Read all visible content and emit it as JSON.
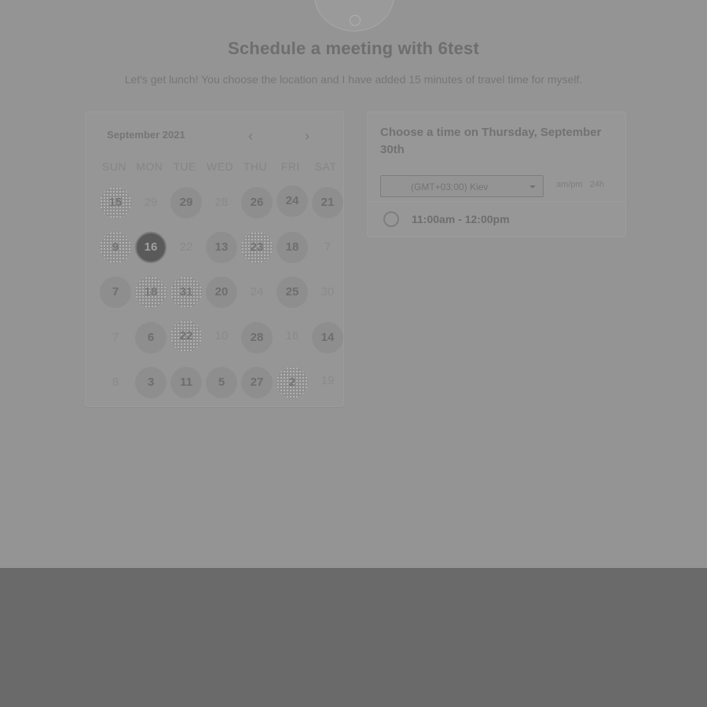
{
  "header": {
    "title": "Schedule a meeting with 6test",
    "subtitle": "Let's get lunch! You choose the location and I have added 15 minutes of travel time for myself."
  },
  "calendar": {
    "month_label": "September 2021",
    "prev_icon": "chevron-left-icon",
    "next_icon": "chevron-right-icon",
    "weekdays": [
      "SUN",
      "MON",
      "TUE",
      "WED",
      "THU",
      "FRI",
      "SAT"
    ],
    "rows": [
      [
        "15",
        "29",
        "29",
        "28",
        "26",
        "24",
        "21"
      ],
      [
        "9",
        "16",
        "22",
        "13",
        "23",
        "18",
        "7"
      ],
      [
        "7",
        "18",
        "31",
        "20",
        "24",
        "25",
        "30"
      ],
      [
        "7",
        "6",
        "22",
        "10",
        "28",
        "16",
        "14"
      ],
      [
        "8",
        "3",
        "11",
        "5",
        "27",
        "2",
        "19"
      ]
    ],
    "selected_day": "16"
  },
  "times": {
    "heading": "Choose a time on Thursday, September 30th",
    "timezone": "(GMT+03:00) Kiev",
    "format_ampm": "am/pm",
    "format_24h": "24h",
    "slots": [
      {
        "label": "11:00am - 12:00pm"
      }
    ]
  },
  "colors": {
    "overlay": "#949494",
    "footer": "#6a6a6a",
    "selected": "#5a5a5a"
  }
}
